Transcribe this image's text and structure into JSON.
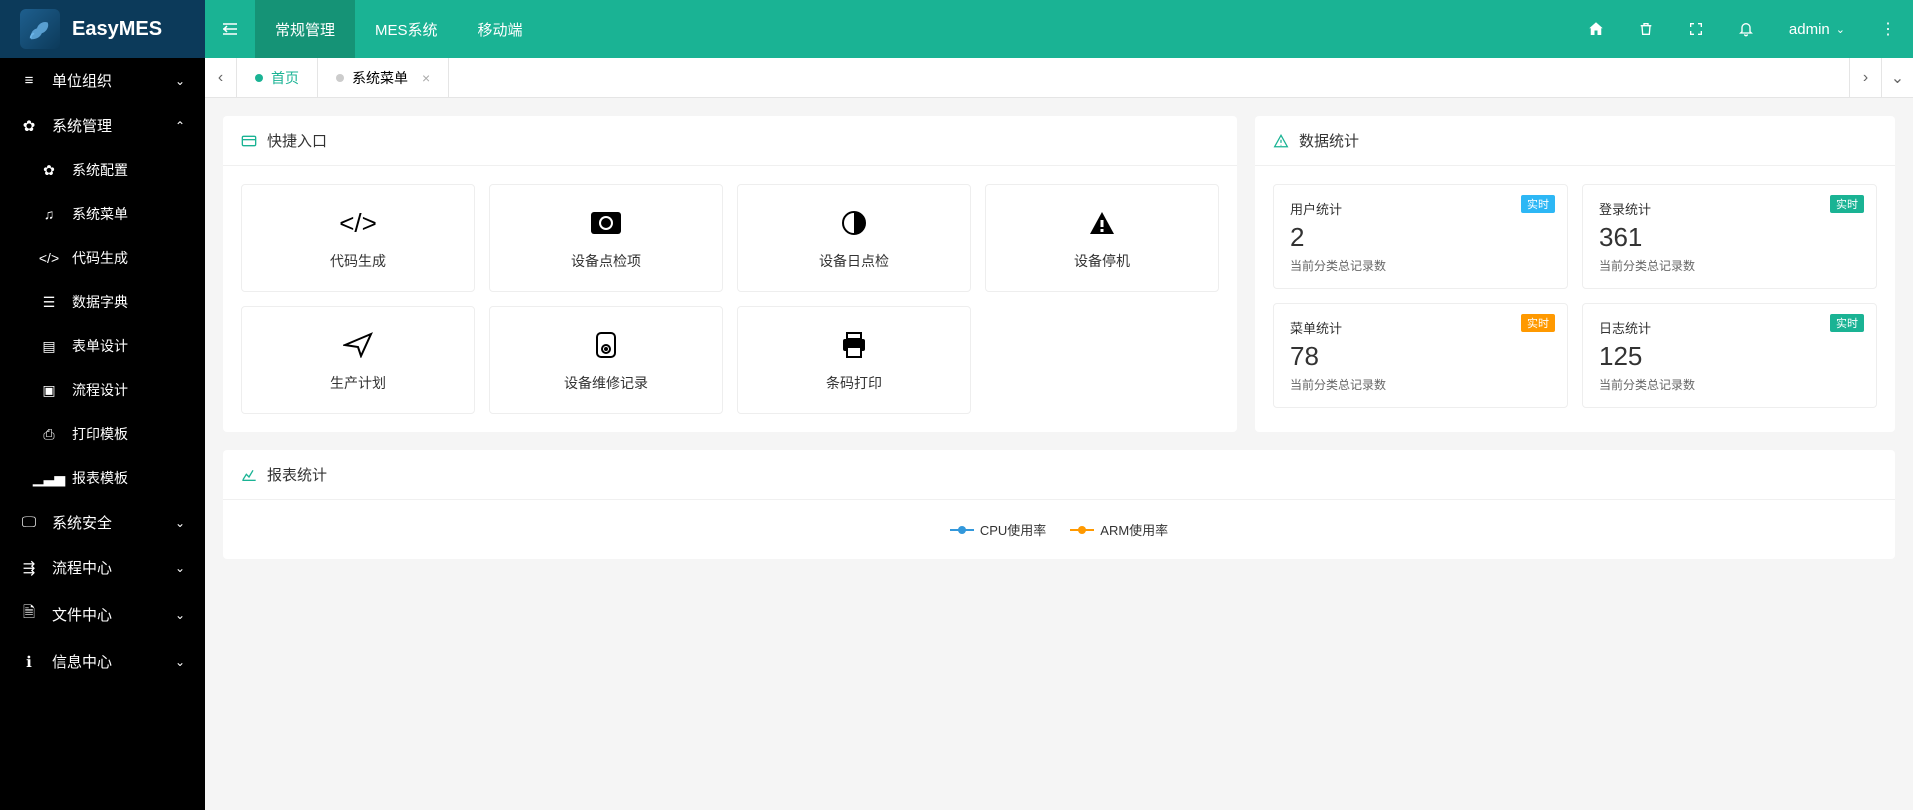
{
  "app": {
    "name": "EasyMES"
  },
  "header": {
    "nav": [
      "常规管理",
      "MES系统",
      "移动端"
    ],
    "active_nav": 0,
    "user": "admin"
  },
  "sidebar": {
    "items": [
      {
        "label": "单位组织",
        "icon": "list",
        "expanded": false
      },
      {
        "label": "系统管理",
        "icon": "gears",
        "expanded": true,
        "children": [
          {
            "label": "系统配置",
            "icon": "gears"
          },
          {
            "label": "系统菜单",
            "icon": "music"
          },
          {
            "label": "代码生成",
            "icon": "code"
          },
          {
            "label": "数据字典",
            "icon": "list-alt"
          },
          {
            "label": "表单设计",
            "icon": "form"
          },
          {
            "label": "流程设计",
            "icon": "flow"
          },
          {
            "label": "打印模板",
            "icon": "print"
          },
          {
            "label": "报表模板",
            "icon": "chart"
          }
        ]
      },
      {
        "label": "系统安全",
        "icon": "monitor",
        "expanded": false
      },
      {
        "label": "流程中心",
        "icon": "flow2",
        "expanded": false
      },
      {
        "label": "文件中心",
        "icon": "file",
        "expanded": false
      },
      {
        "label": "信息中心",
        "icon": "info",
        "expanded": false
      }
    ]
  },
  "tabs": {
    "items": [
      {
        "label": "首页",
        "active": true,
        "closable": false
      },
      {
        "label": "系统菜单",
        "active": false,
        "closable": true
      }
    ]
  },
  "quick": {
    "title": "快捷入口",
    "items": [
      {
        "label": "代码生成",
        "icon": "code"
      },
      {
        "label": "设备点检项",
        "icon": "camera"
      },
      {
        "label": "设备日点检",
        "icon": "contrast"
      },
      {
        "label": "设备停机",
        "icon": "warn"
      },
      {
        "label": "生产计划",
        "icon": "plane"
      },
      {
        "label": "设备维修记录",
        "icon": "disk"
      },
      {
        "label": "条码打印",
        "icon": "print"
      }
    ]
  },
  "stats": {
    "title": "数据统计",
    "items": [
      {
        "title": "用户统计",
        "value": "2",
        "desc": "当前分类总记录数",
        "badge": "实时",
        "badge_color": "blue"
      },
      {
        "title": "登录统计",
        "value": "361",
        "desc": "当前分类总记录数",
        "badge": "实时",
        "badge_color": "teal"
      },
      {
        "title": "菜单统计",
        "value": "78",
        "desc": "当前分类总记录数",
        "badge": "实时",
        "badge_color": "orange"
      },
      {
        "title": "日志统计",
        "value": "125",
        "desc": "当前分类总记录数",
        "badge": "实时",
        "badge_color": "teal"
      }
    ]
  },
  "chart": {
    "title": "报表统计",
    "legend": [
      "CPU使用率",
      "ARM使用率"
    ]
  },
  "chart_data": {
    "type": "line",
    "title": "报表统计",
    "series": [
      {
        "name": "CPU使用率",
        "values": []
      },
      {
        "name": "ARM使用率",
        "values": []
      }
    ]
  }
}
